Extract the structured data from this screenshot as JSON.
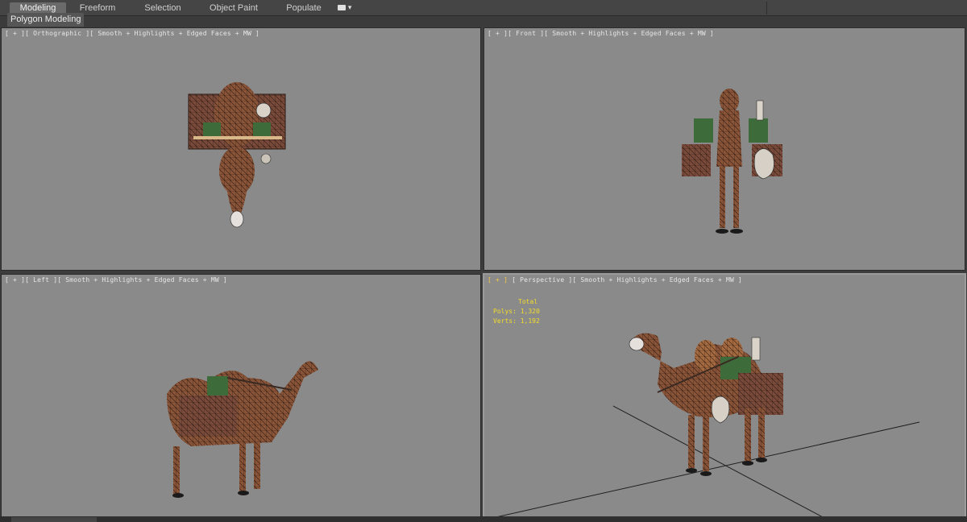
{
  "ribbon": {
    "tabs": [
      {
        "label": "Modeling",
        "active": true
      },
      {
        "label": "Freeform",
        "active": false
      },
      {
        "label": "Selection",
        "active": false
      },
      {
        "label": "Object Paint",
        "active": false
      },
      {
        "label": "Populate",
        "active": false
      }
    ],
    "options_icon": "ribbon-options-icon"
  },
  "subpanel": {
    "label": "Polygon Modeling"
  },
  "viewports": {
    "top": {
      "label": "[ + ][ Orthographic ][ Smooth + Highlights + Edged Faces + MW ]"
    },
    "front": {
      "label": "[ + ][ Front ][ Smooth + Highlights + Edged Faces + MW ]"
    },
    "left": {
      "label": "[ + ][ Left ][ Smooth + Highlights + Edged Faces + MW ]"
    },
    "perspective": {
      "label_plus": "[ + ]",
      "label_rest": "[ Perspective ][ Smooth + Highlights + Edged Faces + MW ]",
      "stats": {
        "header": "Total",
        "polys_label": "Polys:",
        "polys_value": "1,320",
        "verts_label": "Verts:",
        "verts_value": "1,192"
      }
    }
  },
  "colors": {
    "viewport_bg": "#8a8a8a",
    "camel_skin": "#8a5438",
    "wireframe": "#2a1a12",
    "pack_box": "#7a4a3a",
    "green_bag": "#3d6b3a",
    "stats_text": "#f2dc2c"
  }
}
